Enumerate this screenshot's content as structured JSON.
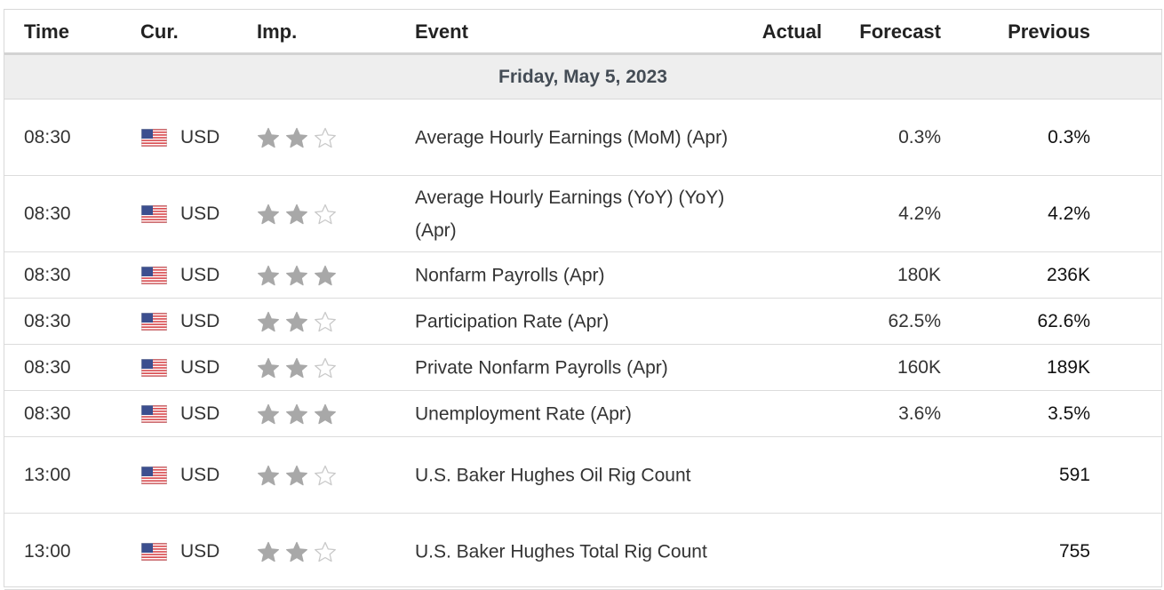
{
  "columns": {
    "time": "Time",
    "currency": "Cur.",
    "importance": "Imp.",
    "event": "Event",
    "actual": "Actual",
    "forecast": "Forecast",
    "previous": "Previous"
  },
  "date_header": "Friday, May 5, 2023",
  "colors": {
    "star_filled": "#a8a8a8",
    "star_empty": "#c9c9c9",
    "date_band": "#eeeeee"
  },
  "rows": [
    {
      "time": "08:30",
      "currency": "USD",
      "flag": "us-flag-icon",
      "stars": 2,
      "event": "Average Hourly Earnings (MoM) (Apr)",
      "actual": "",
      "forecast": "0.3%",
      "previous": "0.3%"
    },
    {
      "time": "08:30",
      "currency": "USD",
      "flag": "us-flag-icon",
      "stars": 2,
      "event": "Average Hourly Earnings (YoY) (YoY) (Apr)",
      "actual": "",
      "forecast": "4.2%",
      "previous": "4.2%"
    },
    {
      "time": "08:30",
      "currency": "USD",
      "flag": "us-flag-icon",
      "stars": 3,
      "event": "Nonfarm Payrolls (Apr)",
      "actual": "",
      "forecast": "180K",
      "previous": "236K"
    },
    {
      "time": "08:30",
      "currency": "USD",
      "flag": "us-flag-icon",
      "stars": 2,
      "event": "Participation Rate (Apr)",
      "actual": "",
      "forecast": "62.5%",
      "previous": "62.6%"
    },
    {
      "time": "08:30",
      "currency": "USD",
      "flag": "us-flag-icon",
      "stars": 2,
      "event": "Private Nonfarm Payrolls (Apr)",
      "actual": "",
      "forecast": "160K",
      "previous": "189K"
    },
    {
      "time": "08:30",
      "currency": "USD",
      "flag": "us-flag-icon",
      "stars": 3,
      "event": "Unemployment Rate (Apr)",
      "actual": "",
      "forecast": "3.6%",
      "previous": "3.5%"
    },
    {
      "time": "13:00",
      "currency": "USD",
      "flag": "us-flag-icon",
      "stars": 2,
      "event": "U.S. Baker Hughes Oil Rig Count",
      "actual": "",
      "forecast": "",
      "previous": "591"
    },
    {
      "time": "13:00",
      "currency": "USD",
      "flag": "us-flag-icon",
      "stars": 2,
      "event": "U.S. Baker Hughes Total Rig Count",
      "actual": "",
      "forecast": "",
      "previous": "755"
    }
  ]
}
